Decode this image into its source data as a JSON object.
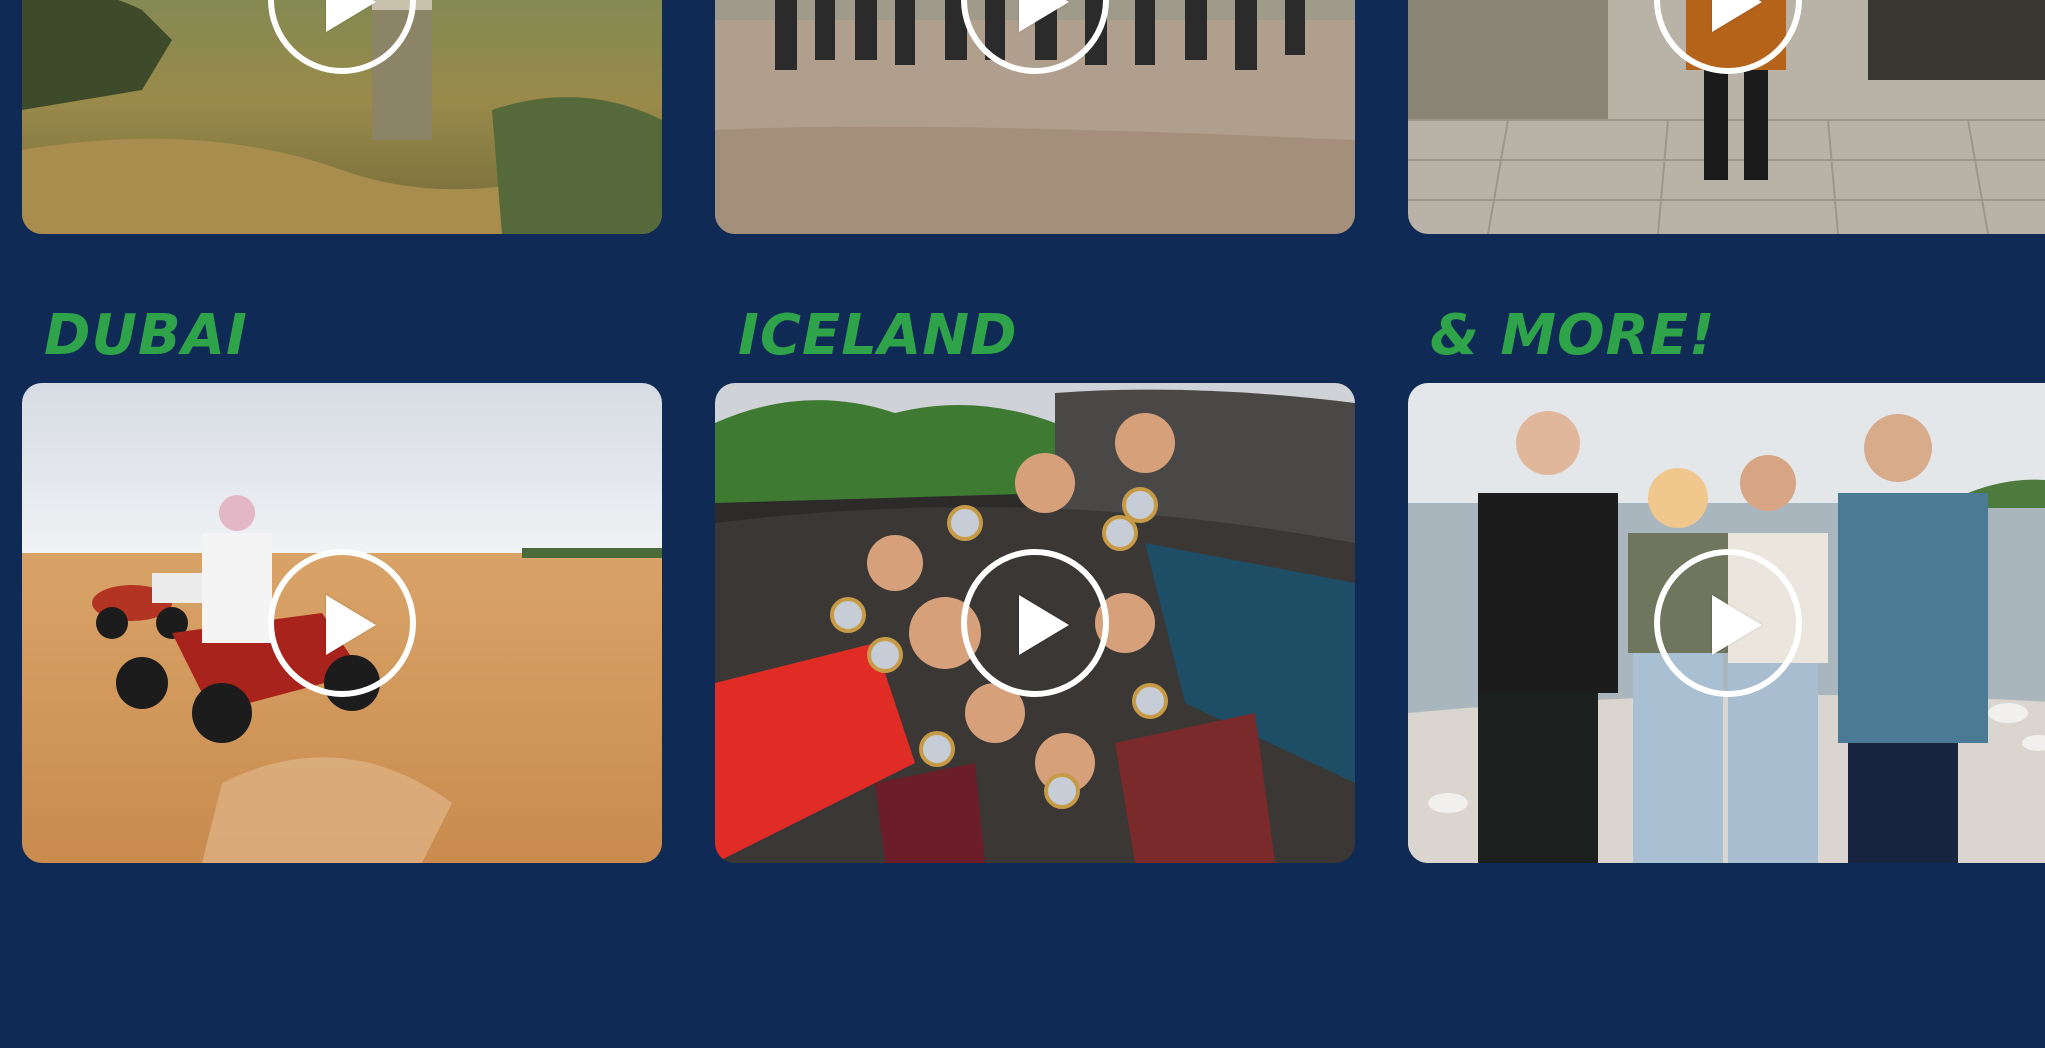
{
  "destinations": [
    {
      "title": "DUBAI",
      "play_icon": "play-icon"
    },
    {
      "title": "ICELAND",
      "play_icon": "play-icon"
    },
    {
      "title": "& MORE!",
      "play_icon": "play-icon"
    }
  ],
  "colors": {
    "background": "#0f2a55",
    "heading": "#2ea34a",
    "play_button": "#ffffff"
  }
}
